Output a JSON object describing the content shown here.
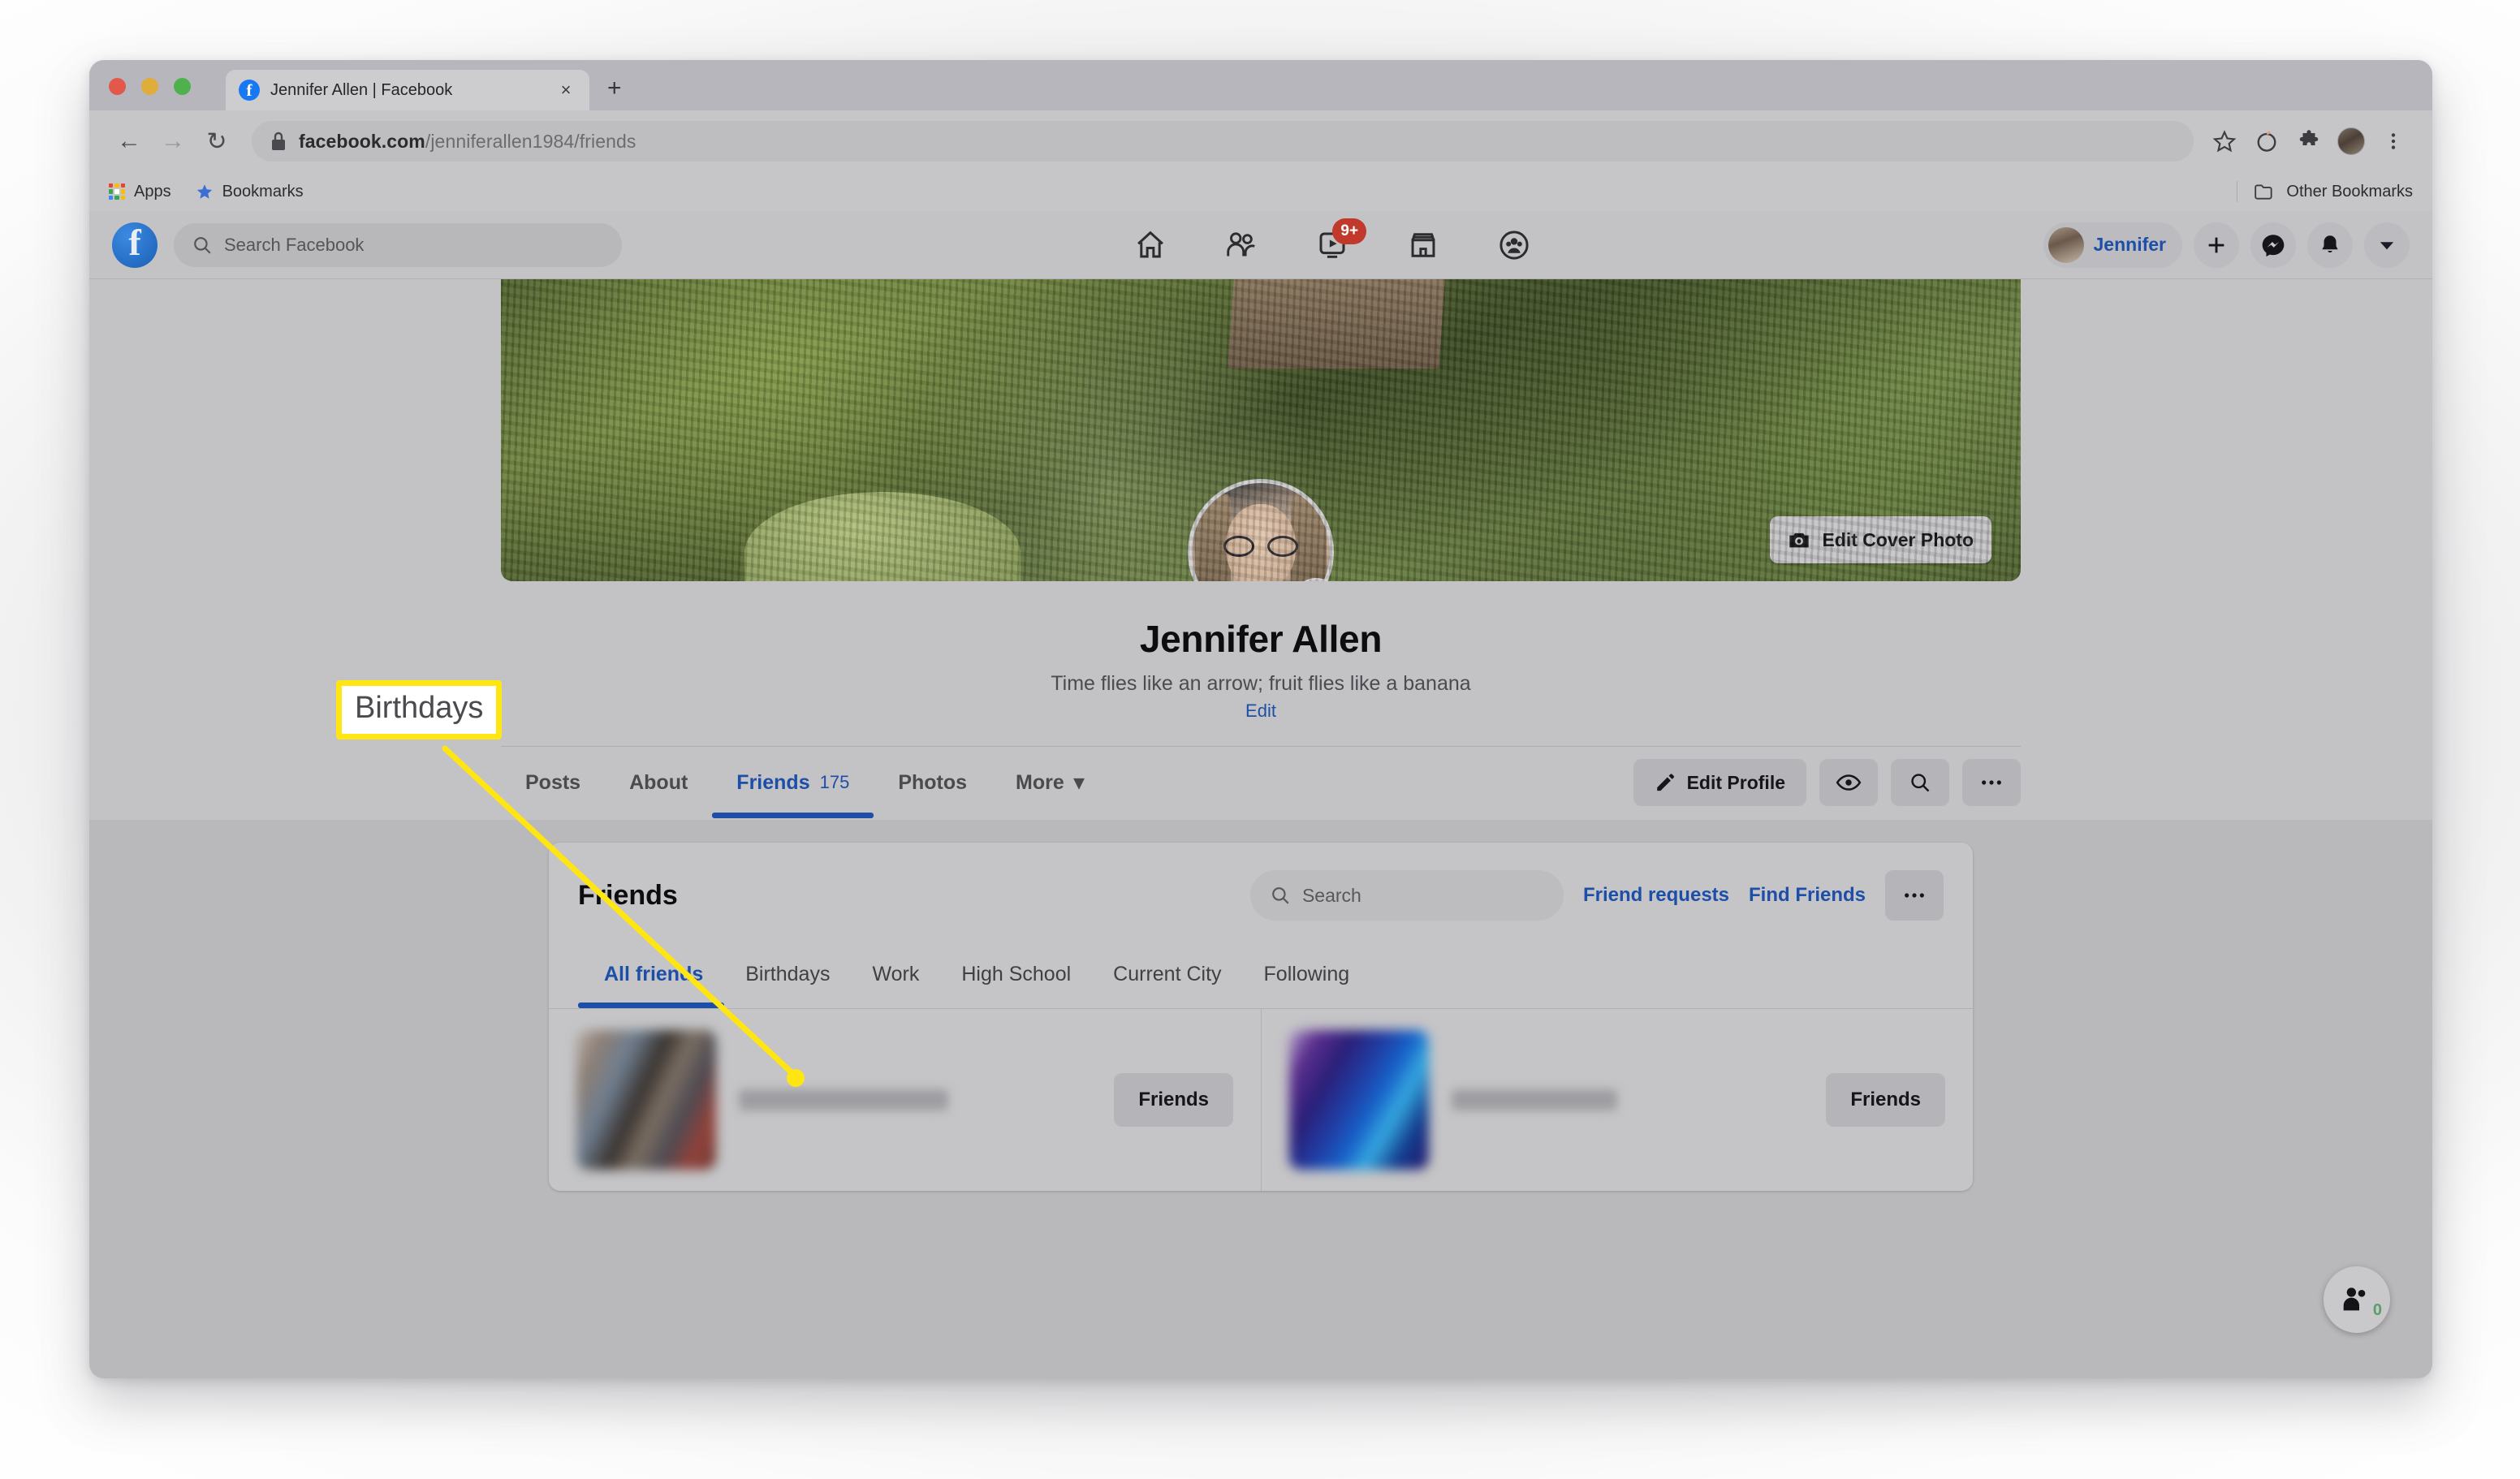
{
  "browser": {
    "tab": {
      "title": "Jennifer Allen | Facebook",
      "favicon": "facebook-icon",
      "close": "×"
    },
    "new_tab_label": "+",
    "nav": {
      "back": "←",
      "forward": "→",
      "reload": "↻"
    },
    "address": {
      "url_main": "facebook.com",
      "url_path": "/jenniferallen1984/friends",
      "lock": "lock-icon"
    },
    "toolbar_icons": [
      "star-icon",
      "history-icon",
      "extensions-puzzle-icon",
      "profile-avatar",
      "chrome-menu-icon"
    ],
    "bookmarks": {
      "apps": "Apps",
      "bookmarks": "Bookmarks",
      "other": "Other Bookmarks"
    }
  },
  "fb_nav": {
    "logo": "facebook-logo",
    "search_placeholder": "Search Facebook",
    "center_tabs": [
      {
        "name": "home",
        "icon": "home-icon",
        "badge": ""
      },
      {
        "name": "friends",
        "icon": "friends-icon",
        "badge": ""
      },
      {
        "name": "watch",
        "icon": "watch-play-icon",
        "badge": "9+"
      },
      {
        "name": "marketplace",
        "icon": "marketplace-store-icon",
        "badge": ""
      },
      {
        "name": "groups",
        "icon": "groups-icon",
        "badge": ""
      }
    ],
    "profile_name": "Jennifer",
    "right_icons": [
      "plus-icon",
      "messenger-icon",
      "bell-notification-icon",
      "chevron-down-icon"
    ]
  },
  "profile": {
    "edit_cover_label": "Edit Cover Photo",
    "edit_cover_icon": "camera-icon",
    "pfp_camera_icon": "camera-icon",
    "name": "Jennifer Allen",
    "bio": "Time flies like an arrow; fruit flies like a banana",
    "edit_link": "Edit",
    "tabs": [
      {
        "label": "Posts",
        "count": "",
        "active": false
      },
      {
        "label": "About",
        "count": "",
        "active": false
      },
      {
        "label": "Friends",
        "count": "175",
        "active": true
      },
      {
        "label": "Photos",
        "count": "",
        "active": false
      },
      {
        "label": "More",
        "count": "",
        "active": false
      }
    ],
    "more_caret": "▾",
    "actions": {
      "edit_profile": "Edit Profile",
      "edit_profile_icon": "pencil-icon",
      "view_as_icon": "eye-icon",
      "search_icon": "search-icon",
      "more_icon": "ellipsis-icon"
    }
  },
  "friends_card": {
    "title": "Friends",
    "search_placeholder": "Search",
    "friend_requests": "Friend requests",
    "find_friends": "Find Friends",
    "more_icon": "ellipsis-icon",
    "subtabs": [
      {
        "label": "All friends",
        "active": true
      },
      {
        "label": "Birthdays",
        "active": false
      },
      {
        "label": "Work",
        "active": false
      },
      {
        "label": "High School",
        "active": false
      },
      {
        "label": "Current City",
        "active": false
      },
      {
        "label": "Following",
        "active": false
      }
    ],
    "rows": [
      {
        "name_redacted": true,
        "status_label": "Friends"
      },
      {
        "name_redacted": true,
        "status_label": "Friends"
      }
    ]
  },
  "fab": {
    "icon": "contacts-icon",
    "badge": "0"
  },
  "annotation": {
    "label": "Birthdays",
    "border_color": "#ffe512",
    "line_color": "#ffe512",
    "points_to": "friends-subtab-birthdays"
  }
}
